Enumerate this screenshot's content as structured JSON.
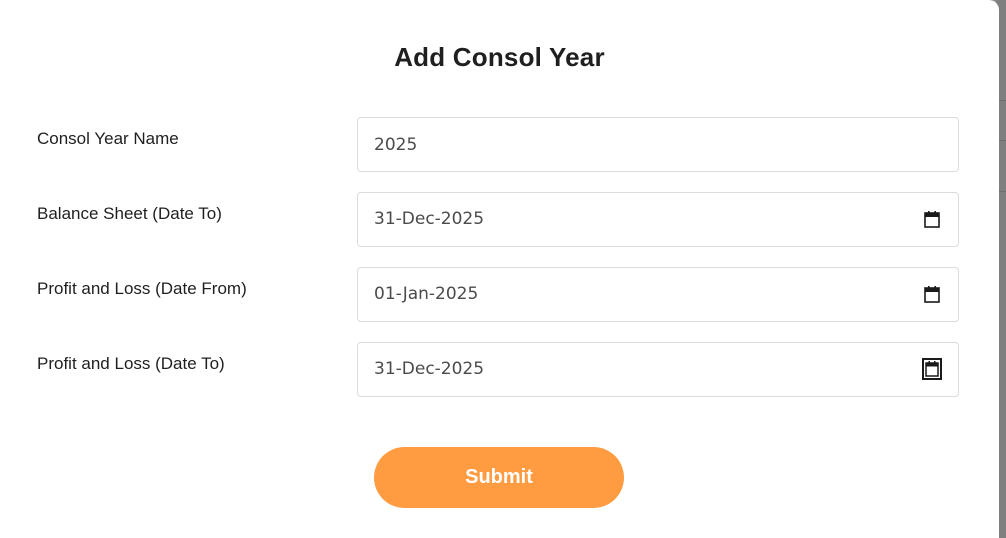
{
  "dialog": {
    "title": "Add Consol Year"
  },
  "form": {
    "fields": [
      {
        "label": "Consol Year Name",
        "value": "2025",
        "type": "text"
      },
      {
        "label": "Balance Sheet (Date To)",
        "value": "31-Dec-2025",
        "type": "date",
        "icon": "calendar-icon"
      },
      {
        "label": "Profit and Loss (Date From)",
        "value": "01-Jan-2025",
        "type": "date",
        "icon": "calendar-icon"
      },
      {
        "label": "Profit and Loss (Date To)",
        "value": "31-Dec-2025",
        "type": "date",
        "icon": "calendar-icon",
        "focused_icon": true
      }
    ],
    "submit_label": "Submit"
  },
  "colors": {
    "accent": "#ff9c42",
    "field_border": "#dcdcdc",
    "text": "#1f1f1f",
    "backdrop": "#8f8f8f"
  }
}
